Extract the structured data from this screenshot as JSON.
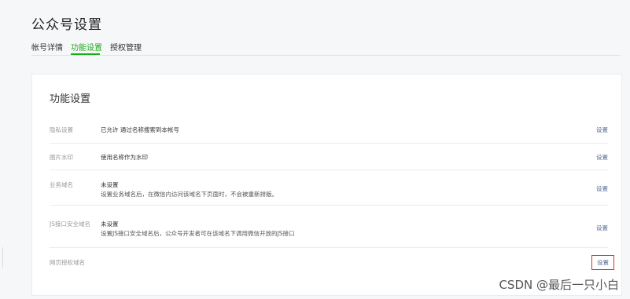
{
  "page_title": "公众号设置",
  "tabs": [
    {
      "label": "帐号详情",
      "active": false
    },
    {
      "label": "功能设置",
      "active": true
    },
    {
      "label": "授权管理",
      "active": false
    }
  ],
  "section_title": "功能设置",
  "rows": [
    {
      "label": "隐私设置",
      "value": "已允许 通过名称搜索到本帐号",
      "description": "",
      "action": "设置"
    },
    {
      "label": "图片水印",
      "value": "使用名称作为水印",
      "description": "",
      "action": "设置"
    },
    {
      "label": "业务域名",
      "value": "未设置",
      "description": "设置业务域名后，在微信内访问该域名下页面时，不会被重新排版。",
      "action": "设置"
    },
    {
      "label": "JS接口安全域名",
      "value": "未设置",
      "description": "设置JS接口安全域名后，公众号开发者可在该域名下调用微信开放的JS接口",
      "action": "设置"
    },
    {
      "label": "网页授权域名",
      "value": "",
      "description": "",
      "action": "设置"
    }
  ],
  "watermark": "CSDN @最后一只小白",
  "colors": {
    "accent_green": "#1aad19",
    "link_blue": "#576b95",
    "highlight_red": "#e02e2e"
  }
}
